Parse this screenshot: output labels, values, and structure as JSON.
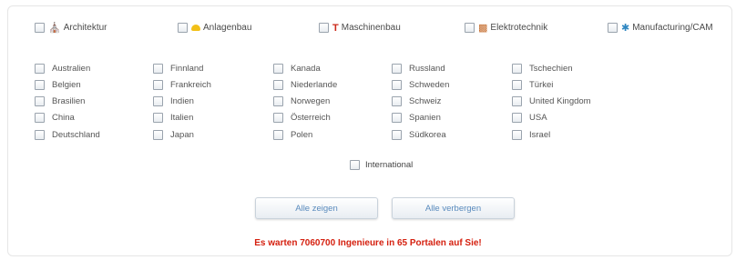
{
  "categories": [
    {
      "label": "Architektur",
      "icon": "building-icon"
    },
    {
      "label": "Anlagenbau",
      "icon": "helmet-icon"
    },
    {
      "label": "Maschinenbau",
      "icon": "wrench-icon"
    },
    {
      "label": "Elektrotechnik",
      "icon": "circuit-icon"
    },
    {
      "label": "Manufacturing/CAM",
      "icon": "gear-icon"
    }
  ],
  "countries": [
    [
      "Australien",
      "Belgien",
      "Brasilien",
      "China",
      "Deutschland"
    ],
    [
      "Finnland",
      "Frankreich",
      "Indien",
      "Italien",
      "Japan"
    ],
    [
      "Kanada",
      "Niederlande",
      "Norwegen",
      "Österreich",
      "Polen"
    ],
    [
      "Russland",
      "Schweden",
      "Schweiz",
      "Spanien",
      "Südkorea"
    ],
    [
      "Tschechien",
      "Türkei",
      "United Kingdom",
      "USA",
      "Israel"
    ]
  ],
  "international": "International",
  "buttons": {
    "show_all": "Alle zeigen",
    "hide_all": "Alle verbergen"
  },
  "message": "Es warten 7060700 Ingenieure in 65 Portalen auf Sie!"
}
